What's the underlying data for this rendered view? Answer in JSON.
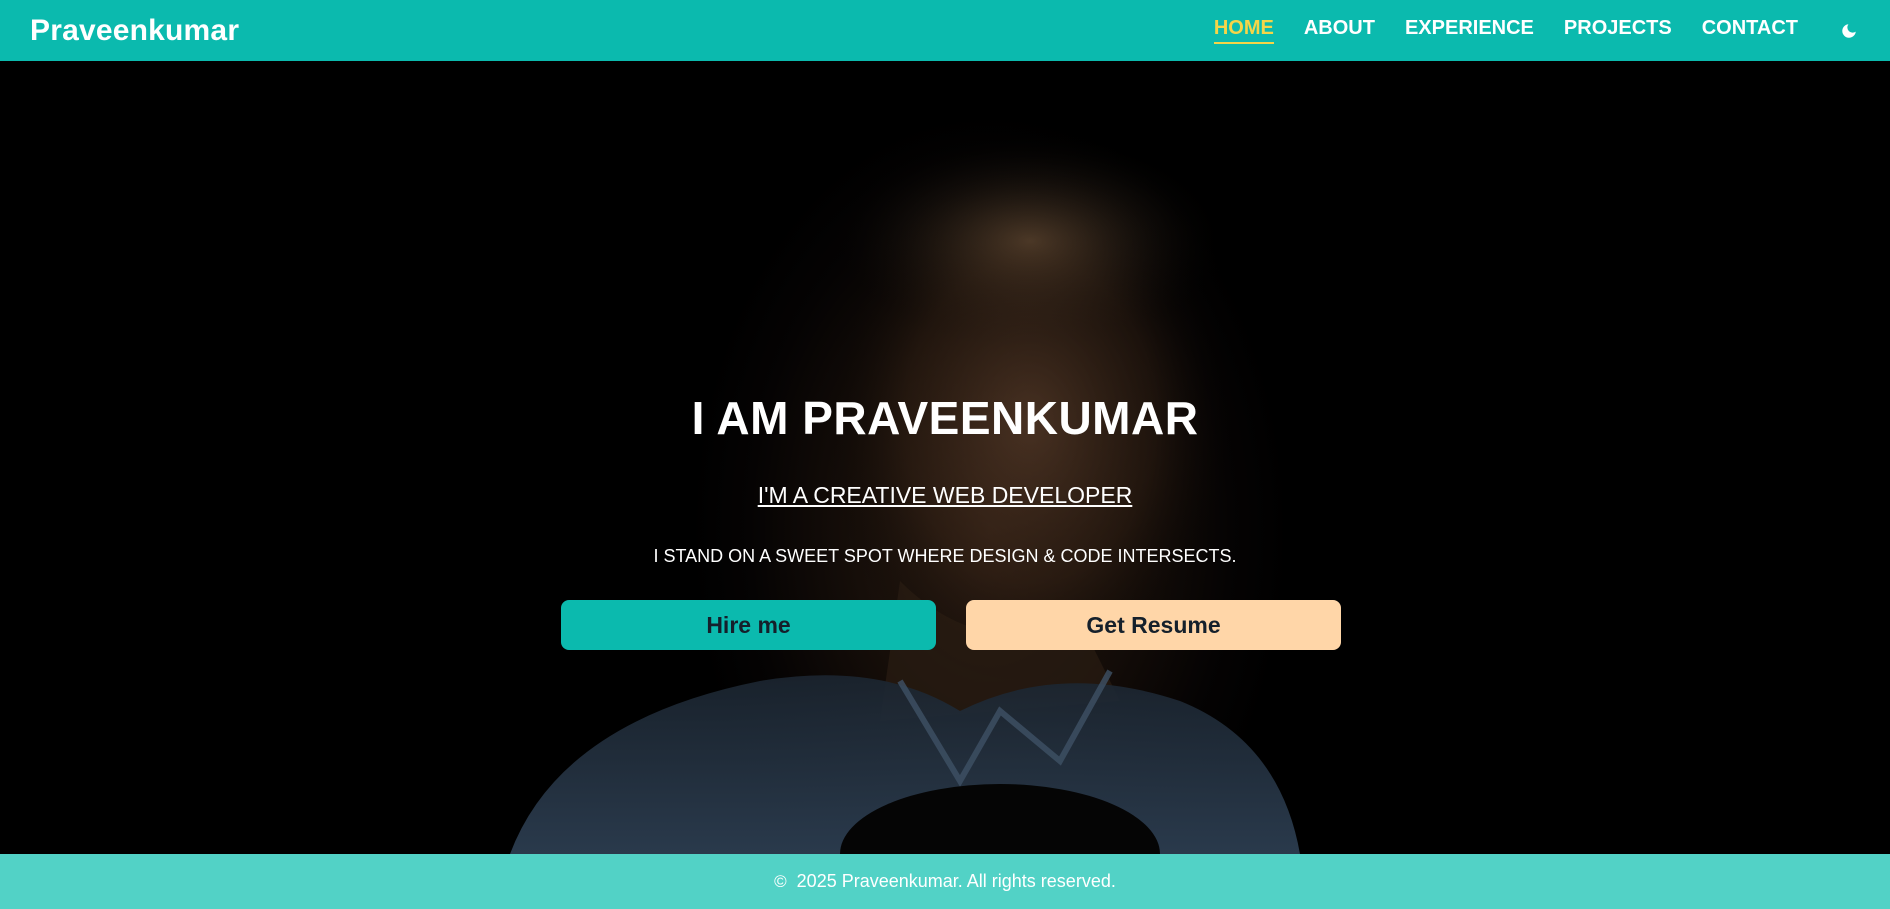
{
  "navbar": {
    "brand": "Praveenkumar",
    "links": [
      {
        "label": "HOME",
        "active": true
      },
      {
        "label": "ABOUT",
        "active": false
      },
      {
        "label": "EXPERIENCE",
        "active": false
      },
      {
        "label": "PROJECTS",
        "active": false
      },
      {
        "label": "CONTACT",
        "active": false
      }
    ],
    "theme_icon": "moon-icon"
  },
  "hero": {
    "title": "I AM PRAVEENKUMAR",
    "subtitle": "I'M A CREATIVE WEB DEVELOPER",
    "tagline": "I STAND ON A SWEET SPOT WHERE DESIGN & CODE INTERSECTS.",
    "buttons": {
      "hire": "Hire me",
      "resume": "Get Resume"
    }
  },
  "footer": {
    "copyright_icon": "©",
    "text": "2025 Praveenkumar. All rights reserved."
  },
  "colors": {
    "primary": "#0bbaae",
    "active_link": "#f5d548",
    "resume_button": "#ffd6a8",
    "footer": "#52d2c6"
  }
}
